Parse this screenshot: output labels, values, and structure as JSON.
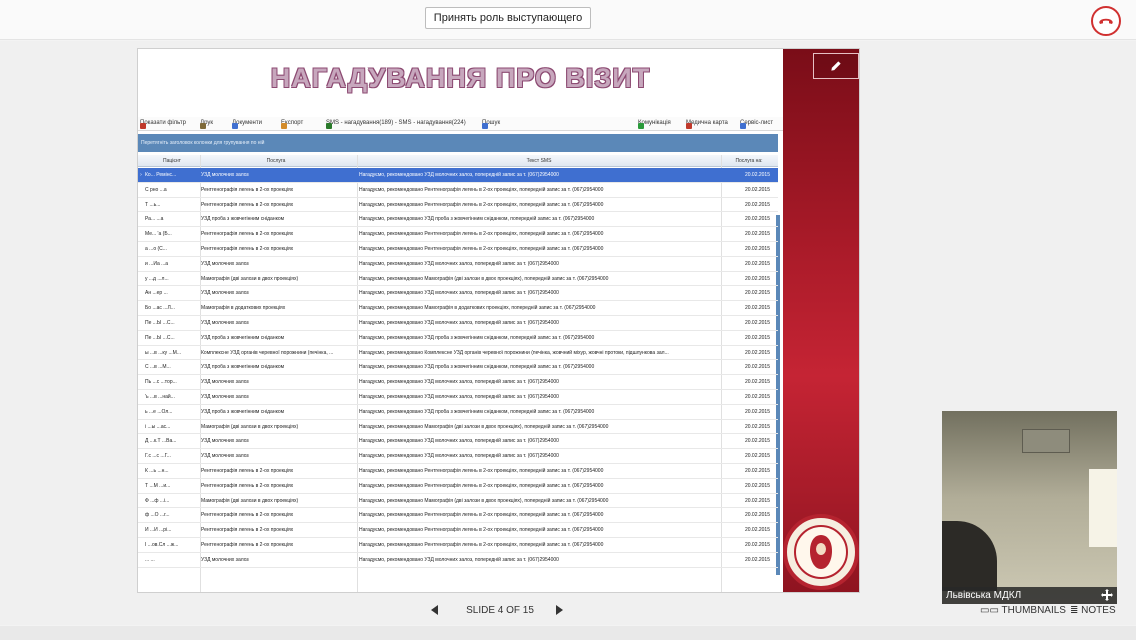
{
  "topbar": {
    "role_button": "Принять роль выступающего"
  },
  "slide": {
    "title": "НАГАДУВАННЯ ПРО ВІЗИТ",
    "toolbar": [
      {
        "label": "Показати фільтр",
        "icon": "filter-icon"
      },
      {
        "label": "Друк",
        "icon": "printer-icon"
      },
      {
        "label": "Документи",
        "icon": "document-icon"
      },
      {
        "label": "Експорт",
        "icon": "export-icon"
      },
      {
        "label": "SMS - нагадування(189) - SMS - нагадування(224)",
        "icon": "sms-icon"
      },
      {
        "label": "Пошук",
        "icon": "search-icon"
      },
      {
        "label": "Комунікація",
        "icon": "communication-icon"
      },
      {
        "label": "Медична карта",
        "icon": "medical-card-icon"
      },
      {
        "label": "Сервіс-лист",
        "icon": "service-icon"
      }
    ],
    "group_hint": "Перетягніть заголовок колонки для групування по ній",
    "columns": [
      "Пацієнт",
      "Послуга",
      "Текст SMS",
      "Послуга на:"
    ],
    "rows": [
      {
        "patient": "Ко... Ремінс...",
        "service": "УЗД молочних залоз",
        "text": "Нагадуємо, рекомендовано УЗД молочних залоз, попередній запис за т. (067)2954000",
        "date": "20.02.2015"
      },
      {
        "patient": "С рно ...а",
        "service": "Рентгенографія легень в 2-ох проекціях",
        "text": "Нагадуємо, рекомендовано Рентгенографія легень в 2-ох проекціях, попередній запис за т. (067)2954000",
        "date": "20.02.2015"
      },
      {
        "patient": "Т ...ь...",
        "service": "Рентгенографія легень в 2-ох проекціях",
        "text": "Нагадуємо, рекомендовано Рентгенографія легень в 2-ох проекціях, попередній запис за т. (067)2954000",
        "date": "20.02.2015"
      },
      {
        "patient": "Ра... ...а",
        "service": "УЗД проба з жовчегінним сніданком",
        "text": "Нагадуємо, рекомендовано УЗД проба з жовчегінним сніданком, попередній запис за т. (067)2954000",
        "date": "20.02.2015"
      },
      {
        "patient": "Ме... 'а (Б...",
        "service": "Рентгенографія легень в 2-ох проекціях",
        "text": "Нагадуємо, рекомендовано Рентгенографія легень в 2-ох проекціях, попередній запис за т. (067)2954000",
        "date": "20.02.2015"
      },
      {
        "patient": "а ...о (С...",
        "service": "Рентгенографія легень в 2-ох проекціях",
        "text": "Нагадуємо, рекомендовано Рентгенографія легень в 2-ох проекціях, попередній запис за т. (067)2954000",
        "date": "20.02.2015"
      },
      {
        "patient": "и ...Иа ...а",
        "service": "УЗД молочних залоз",
        "text": "Нагадуємо, рекомендовано УЗД молочних залоз, попередній запис за т. (067)2954000",
        "date": "20.02.2015"
      },
      {
        "patient": "у ...д ...л...",
        "service": "Мамографія (дві залози в двох проекціях)",
        "text": "Нагадуємо, рекомендовано Мамографія (дві залози в двох проекціях), попередній запис за т. (067)2954000",
        "date": "20.02.2015"
      },
      {
        "patient": "Ан ...ер ...",
        "service": "УЗД молочних залоз",
        "text": "Нагадуємо, рекомендовано УЗД молочних залоз, попередній запис за т. (067)2954000",
        "date": "20.02.2015"
      },
      {
        "patient": "Бо ...ас ...Л...",
        "service": "Мамографія в додаткових проекціях",
        "text": "Нагадуємо, рекомендовано Мамографія в додаткових проекціях, попередній запис за т. (067)2954000",
        "date": "20.02.2015"
      },
      {
        "patient": "Пе ...Ы ...С...",
        "service": "УЗД молочних залоз",
        "text": "Нагадуємо, рекомендовано УЗД молочних залоз, попередній запис за т. (067)2954000",
        "date": "20.02.2015"
      },
      {
        "patient": "Пе ...Ы ...С...",
        "service": "УЗД проба з жовчегінним сніданком",
        "text": "Нагадуємо, рекомендовано УЗД проба з жовчегінним сніданком, попередній запис за т. (067)2954000",
        "date": "20.02.2015"
      },
      {
        "patient": "ы ...в ...ку ...М...",
        "service": "Комплексне УЗД органів черевної порожнини (печінка, ...",
        "text": "Нагадуємо, рекомендовано Комплексне УЗД органів черевної порожнини (печінка, жовчний міхур, жовчні протоки, підшлункова зал...",
        "date": "20.02.2015"
      },
      {
        "patient": "С ...в ...М...",
        "service": "УЗД проба з жовчегінним сніданком",
        "text": "Нагадуємо, рекомендовано УЗД проба з жовчегінним сніданком, попередній запис за т. (067)2954000",
        "date": "20.02.2015"
      },
      {
        "patient": "Пь ...с ...тор...",
        "service": "УЗД молочних залоз",
        "text": "Нагадуємо, рекомендовано УЗД молочних залоз, попередній запис за т. (067)2954000",
        "date": "20.02.2015"
      },
      {
        "patient": "'ь ...в ...най...",
        "service": "УЗД молочних залоз",
        "text": "Нагадуємо, рекомендовано УЗД молочних залоз, попередній запис за т. (067)2954000",
        "date": "20.02.2015"
      },
      {
        "patient": "ь ...е ...Ол...",
        "service": "УЗД проба з жовчегінним сніданком",
        "text": "Нагадуємо, рекомендовано УЗД проба з жовчегінним сніданком, попередній запис за т. (067)2954000",
        "date": "20.02.2015"
      },
      {
        "patient": "і ...ы ...ас...",
        "service": "Мамографія (дві залози в двох проекціях)",
        "text": "Нагадуємо, рекомендовано Мамографія (дві залози в двох проекціях), попередній запис за т. (067)2954000",
        "date": "20.02.2015"
      },
      {
        "patient": "Д ...к.Т ...Ва...",
        "service": "УЗД молочних залоз",
        "text": "Нагадуємо, рекомендовано УЗД молочних залоз, попередній запис за т. (067)2954000",
        "date": "20.02.2015"
      },
      {
        "patient": "Г.с ...с ...Г...",
        "service": "УЗД молочних залоз",
        "text": "Нагадуємо, рекомендовано УЗД молочних залоз, попередній запис за т. (067)2954000",
        "date": "20.02.2015"
      },
      {
        "patient": "К ...ь ...н...",
        "service": "Рентгенографія легень в 2-ох проекціях",
        "text": "Нагадуємо, рекомендовано Рентгенографія легень в 2-ох проекціях, попередній запис за т. (067)2954000",
        "date": "20.02.2015"
      },
      {
        "patient": "Т ...М ...и...",
        "service": "Рентгенографія легень в 2-ох проекціях",
        "text": "Нагадуємо, рекомендовано Рентгенографія легень в 2-ох проекціях, попередній запис за т. (067)2954000",
        "date": "20.02.2015"
      },
      {
        "patient": "Ф ...ф ...і...",
        "service": "Мамографія (дві залози в двох проекціях)",
        "text": "Нагадуємо, рекомендовано Мамографія (дві залози в двох проекціях), попередній запис за т. (067)2954000",
        "date": "20.02.2015"
      },
      {
        "patient": "ф ...О ...г...",
        "service": "Рентгенографія легень в 2-ох проекціях",
        "text": "Нагадуємо, рекомендовано Рентгенографія легень в 2-ох проекціях, попередній запис за т. (067)2954000",
        "date": "20.02.2015"
      },
      {
        "patient": "И ...И ...рі...",
        "service": "Рентгенографія легень в 2-ох проекціях",
        "text": "Нагадуємо, рекомендовано Рентгенографія легень в 2-ох проекціях, попередній запис за т. (067)2954000",
        "date": "20.02.2015"
      },
      {
        "patient": "І ...ов.Сл ...ж...",
        "service": "Рентгенографія легень в 2-ох проекціях",
        "text": "Нагадуємо, рекомендовано Рентгенографія легень в 2-ох проекціях, попередній запис за т. (067)2954000",
        "date": "20.02.2015"
      },
      {
        "patient": "... ...",
        "service": "УЗД молочних залоз",
        "text": "Нагадуємо, рекомендовано УЗД молочних залоз, попередній запис за т. (067)2954000",
        "date": "20.02.2015"
      }
    ]
  },
  "video": {
    "caption": "Львівська МДКЛ"
  },
  "bottom": {
    "slide_counter": "SLIDE 4 OF 15",
    "thumbnails_label": "THUMBNAILS",
    "notes_label": "NOTES"
  },
  "colors": {
    "accent_red": "#c52434",
    "grid_header_blue": "#5b88b8",
    "selection_blue": "#3f6fd0"
  }
}
